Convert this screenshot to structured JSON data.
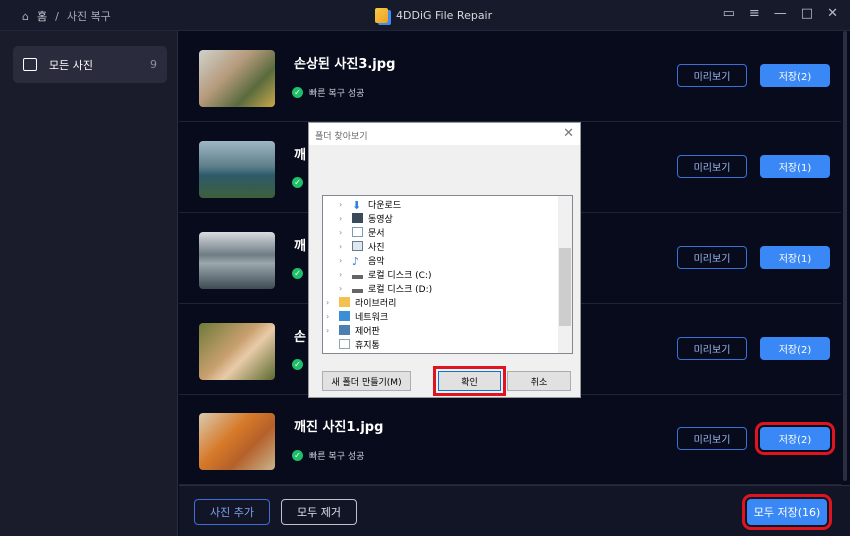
{
  "titlebar": {
    "home": "홈",
    "separator": "/",
    "current": "사진 복구",
    "app_title": "4DDiG File Repair"
  },
  "sidebar": {
    "label": "모든 사진",
    "count": "9"
  },
  "rows": [
    {
      "title": "손상된 사진3.jpg",
      "status": "빠른 복구 성공",
      "preview": "미리보기",
      "save": "저장(2)"
    },
    {
      "title": "깨",
      "status": "",
      "preview": "미리보기",
      "save": "저장(1)"
    },
    {
      "title": "깨",
      "status": "",
      "preview": "미리보기",
      "save": "저장(1)"
    },
    {
      "title": "손",
      "status": "",
      "preview": "미리보기",
      "save": "저장(2)"
    },
    {
      "title": "깨진 사진1.jpg",
      "status": "빠른 복구 성공",
      "preview": "미리보기",
      "save": "저장(2)"
    }
  ],
  "footer": {
    "add": "사진 추가",
    "remove_all": "모두 제거",
    "save_all": "모두 저장(16)"
  },
  "dialog": {
    "title": "폴더 찾아보기",
    "items": [
      "다운로드",
      "동영상",
      "문서",
      "사진",
      "음악",
      "로컬 디스크 (C:)",
      "로컬 디스크 (D:)",
      "라이브러리",
      "네트워크",
      "제어판",
      "휴지통"
    ],
    "new_folder": "새 폴더 만들기(M)",
    "ok": "확인",
    "cancel": "취소"
  }
}
